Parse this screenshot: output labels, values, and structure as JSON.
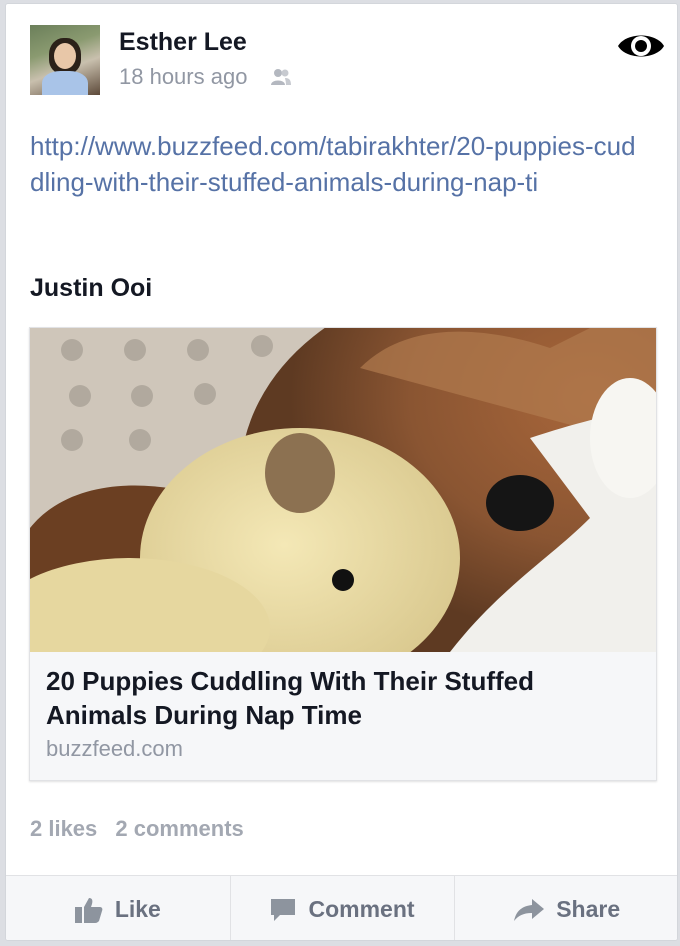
{
  "post": {
    "author": "Esther Lee",
    "timestamp": "18 hours ago",
    "link": "http://www.buzzfeed.com/tabirakhter/20-puppies-cuddling-with-their-stuffed-animals-during-nap-ti",
    "tagged_name": "Justin Ooi"
  },
  "preview": {
    "title": "20 Puppies Cuddling With Their Stuffed Animals During Nap Time",
    "domain": "buzzfeed.com"
  },
  "stats": {
    "likes": "2 likes",
    "comments": "2 comments"
  },
  "actions": {
    "like": "Like",
    "comment": "Comment",
    "share": "Share"
  },
  "colors": {
    "link": "#5672a6",
    "muted": "#9197a3",
    "action": "#6a7180"
  }
}
